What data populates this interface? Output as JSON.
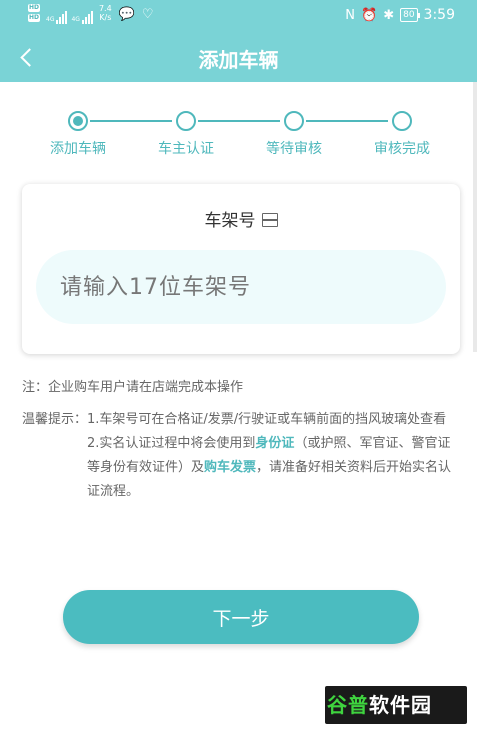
{
  "status_bar": {
    "hd1": "HD",
    "hd2": "HD",
    "net1": "4G",
    "net2": "4G",
    "speed_value": "7.4",
    "speed_unit": "K/s",
    "chat_icon": "wechat-icon",
    "health_icon": "heart-icon",
    "nfc_icon": "nfc-icon",
    "alarm_icon": "alarm-icon",
    "bluetooth_icon": "bluetooth-icon",
    "battery": "80",
    "time": "3:59"
  },
  "header": {
    "title": "添加车辆"
  },
  "steps": [
    {
      "label": "添加车辆",
      "active": true
    },
    {
      "label": "车主认证",
      "active": false
    },
    {
      "label": "等待审核",
      "active": false
    },
    {
      "label": "审核完成",
      "active": false
    }
  ],
  "form": {
    "title": "车架号",
    "vin_placeholder": "请输入17位车架号",
    "vin_value": ""
  },
  "notes": {
    "note_label": "注：",
    "note_text": "企业购车用户请在店端完成本操作",
    "tip_label": "温馨提示：",
    "tip1": "1.车架号可在合格证/发票/行驶证或车辆前面的挡风玻璃处查看",
    "tip2_part1": "2.实名认证过程中将会使用到",
    "tip2_hl1": "身份证",
    "tip2_part2": "（或护照、军官证、警官证等身份有效证件）及",
    "tip2_hl2": "购车发票",
    "tip2_part3": "，请准备好相关资料后开始实名认证流程。"
  },
  "next_button": "下一步",
  "watermark": {
    "part1": "谷普",
    "part2": "软件园"
  },
  "colors": {
    "header_bg": "#7ad3d6",
    "accent": "#4fb8bc",
    "button": "#4bbcc0",
    "input_bg": "#eefbfc"
  }
}
